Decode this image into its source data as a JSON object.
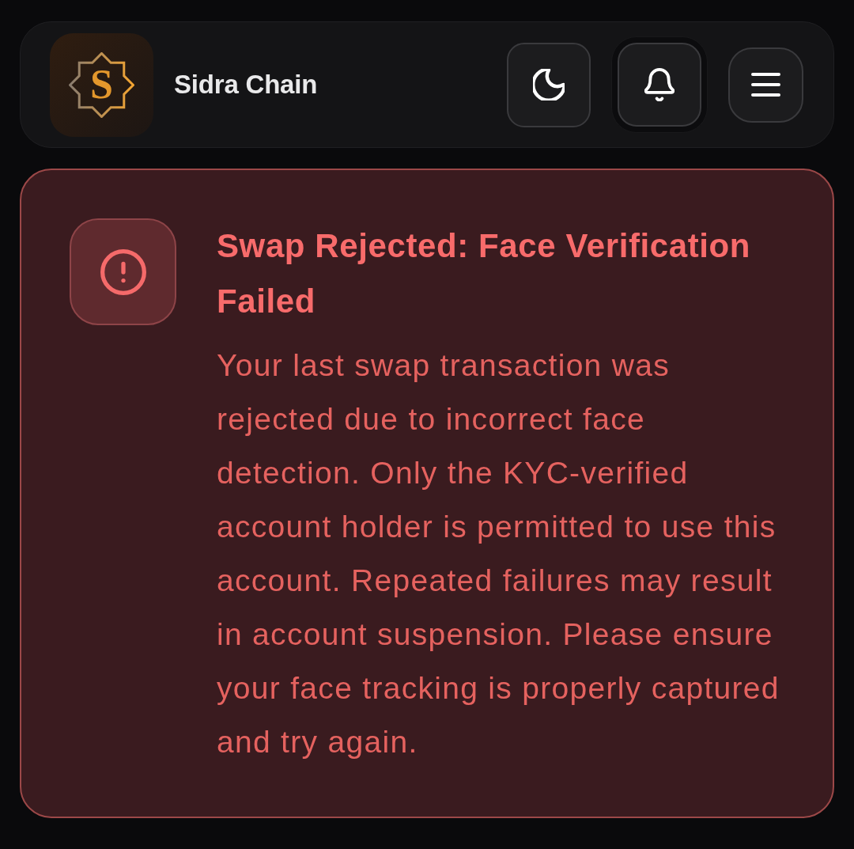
{
  "header": {
    "logo": {
      "letter": "S"
    },
    "title": "Sidra Chain",
    "actions": [
      {
        "kind": "theme",
        "highlighted": false
      },
      {
        "kind": "notifications",
        "highlighted": true
      },
      {
        "kind": "menu",
        "highlighted": false
      }
    ]
  },
  "alert": {
    "kind": "error",
    "title": "Swap Rejected: Face Verification Failed",
    "message": "Your last swap transaction was rejected due to incorrect face detection. Only the KYC-verified account holder is permitted to use this account. Repeated failures may result in account suspension. Please ensure your face tracking is properly captured and try again."
  }
}
